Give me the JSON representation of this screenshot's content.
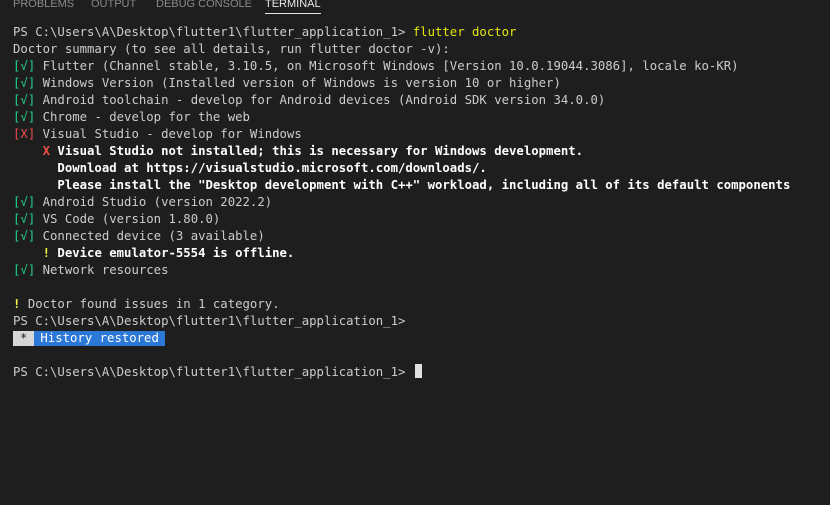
{
  "tabs": [
    {
      "label": "PROBLEMS"
    },
    {
      "label": "OUTPUT"
    },
    {
      "label": "DEBUG CONSOLE"
    },
    {
      "label": "TERMINAL",
      "active": true
    }
  ],
  "terminal": {
    "prompt": "PS C:\\Users\\A\\Desktop\\flutter1\\flutter_application_1> ",
    "command": "flutter doctor",
    "summary": "Doctor summary (to see all details, run flutter doctor -v):",
    "checks": [
      {
        "mark_open": "[",
        "mark": "√",
        "mark_close": "]",
        "text": " Flutter (Channel stable, 3.10.5, on Microsoft Windows [Version 10.0.19044.3086], locale ko-KR)"
      },
      {
        "mark_open": "[",
        "mark": "√",
        "mark_close": "]",
        "text": " Windows Version (Installed version of Windows is version 10 or higher)"
      },
      {
        "mark_open": "[",
        "mark": "√",
        "mark_close": "]",
        "text": " Android toolchain - develop for Android devices (Android SDK version 34.0.0)"
      },
      {
        "mark_open": "[",
        "mark": "√",
        "mark_close": "]",
        "text": " Chrome - develop for the web"
      },
      {
        "mark_open": "[",
        "mark": "X",
        "mark_close": "]",
        "text": " Visual Studio - develop for Windows"
      },
      {
        "mark_open": "[",
        "mark": "√",
        "mark_close": "]",
        "text": " Android Studio (version 2022.2)"
      },
      {
        "mark_open": "[",
        "mark": "√",
        "mark_close": "]",
        "text": " VS Code (version 1.80.0)"
      },
      {
        "mark_open": "[",
        "mark": "√",
        "mark_close": "]",
        "text": " Connected device (3 available)"
      },
      {
        "mark_open": "[",
        "mark": "√",
        "mark_close": "]",
        "text": " Network resources"
      }
    ],
    "vs_detail_marker": "    X ",
    "vs_detail_1": "Visual Studio not installed; this is necessary for Windows development.",
    "vs_detail_2": "      Download at https://visualstudio.microsoft.com/downloads/.",
    "vs_detail_3": "      Please install the \"Desktop development with C++\" workload, including all of its default components",
    "device_warn_marker": "    ! ",
    "device_warn_text": "Device emulator-5554 is offline.",
    "issues_marker": "! ",
    "issues_text": "Doctor found issues in 1 category.",
    "prompt_line": "PS C:\\Users\\A\\Desktop\\flutter1\\flutter_application_1>",
    "history_star": "*",
    "history_label": "History restored",
    "final_prompt": "PS C:\\Users\\A\\Desktop\\flutter1\\flutter_application_1> "
  },
  "colors": {
    "background": "#1e1e1e",
    "text": "#cccccc",
    "ok": "#23d18b",
    "error": "#f14c4c",
    "warning": "#f5f543",
    "command": "#e5e510",
    "history_badge": "#2b78d6"
  }
}
